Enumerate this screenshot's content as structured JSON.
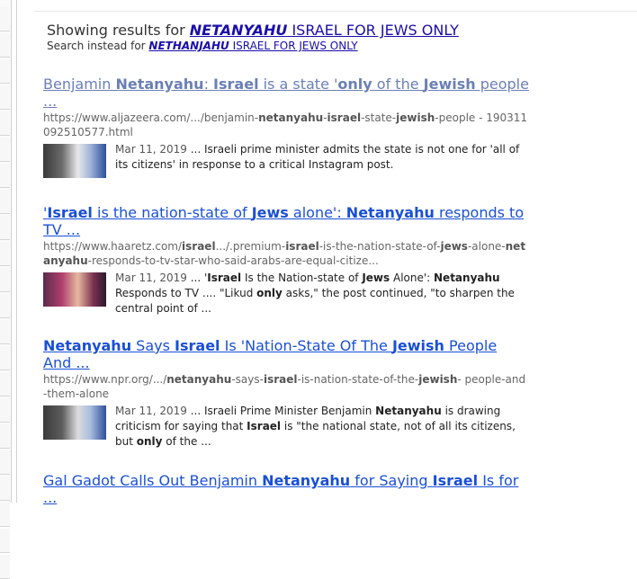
{
  "spell": {
    "showing_prefix": "Showing results for ",
    "showing_bold": "NETANYAHU",
    "showing_rest": " ISRAEL FOR JEWS ONLY",
    "instead_prefix": "Search instead for ",
    "instead_bold": "NETHANJAHU",
    "instead_rest": " ISRAEL FOR JEWS ONLY"
  },
  "results": [
    {
      "title_parts": [
        {
          "t": "Benjamin ",
          "b": false
        },
        {
          "t": "Netanyahu",
          "b": true
        },
        {
          "t": ": ",
          "b": false
        },
        {
          "t": "Israel",
          "b": true
        },
        {
          "t": " is a state '",
          "b": false
        },
        {
          "t": "only",
          "b": true
        },
        {
          "t": " of the ",
          "b": false
        },
        {
          "t": "Jewish",
          "b": true
        },
        {
          "t": " people ...",
          "b": false
        }
      ],
      "visited": true,
      "url_parts": [
        {
          "t": "https://www.aljazeera.com/.../benjamin-",
          "b": false
        },
        {
          "t": "netanyahu",
          "b": true
        },
        {
          "t": "-",
          "b": false
        },
        {
          "t": "israel",
          "b": true
        },
        {
          "t": "-state-",
          "b": false
        },
        {
          "t": "jewish",
          "b": true
        },
        {
          "t": "-people - 190311092510577.html",
          "b": false
        }
      ],
      "date": "Mar 11, 2019",
      "snippet_parts": [
        {
          "t": " ... Israeli prime minister admits the state is not one for 'all of its citizens' in response to a critical Instagram post.",
          "b": false
        }
      ]
    },
    {
      "title_parts": [
        {
          "t": "'",
          "b": false
        },
        {
          "t": "Israel",
          "b": true
        },
        {
          "t": " is the nation-state of ",
          "b": false
        },
        {
          "t": "Jews",
          "b": true
        },
        {
          "t": " alone': ",
          "b": false
        },
        {
          "t": "Netanyahu",
          "b": true
        },
        {
          "t": " responds to TV ...",
          "b": false
        }
      ],
      "visited": false,
      "url_parts": [
        {
          "t": "https://www.haaretz.com/",
          "b": false
        },
        {
          "t": "israel",
          "b": true
        },
        {
          "t": ".../.premium-",
          "b": false
        },
        {
          "t": "israel",
          "b": true
        },
        {
          "t": "-is-the-nation-state-of-",
          "b": false
        },
        {
          "t": "jews",
          "b": true
        },
        {
          "t": "-alone-",
          "b": false
        },
        {
          "t": "netanyahu",
          "b": true
        },
        {
          "t": "-responds-to-tv-star-who-said-arabs-are-equal-citize...",
          "b": false
        }
      ],
      "date": "Mar 11, 2019",
      "snippet_parts": [
        {
          "t": " ... '",
          "b": false
        },
        {
          "t": "Israel",
          "b": true
        },
        {
          "t": " Is the Nation-state of ",
          "b": false
        },
        {
          "t": "Jews",
          "b": true
        },
        {
          "t": " Alone': ",
          "b": false
        },
        {
          "t": "Netanyahu",
          "b": true
        },
        {
          "t": " Responds to TV .... \"Likud ",
          "b": false
        },
        {
          "t": "only",
          "b": true
        },
        {
          "t": " asks,\" the post continued, \"to sharpen the central point of ...",
          "b": false
        }
      ]
    },
    {
      "title_parts": [
        {
          "t": "Netanyahu",
          "b": true
        },
        {
          "t": " Says ",
          "b": false
        },
        {
          "t": "Israel",
          "b": true
        },
        {
          "t": " Is 'Nation-State Of The ",
          "b": false
        },
        {
          "t": "Jewish",
          "b": true
        },
        {
          "t": " People And ...",
          "b": false
        }
      ],
      "visited": false,
      "url_parts": [
        {
          "t": "https://www.npr.org/.../",
          "b": false
        },
        {
          "t": "netanyahu",
          "b": true
        },
        {
          "t": "-says-",
          "b": false
        },
        {
          "t": "israel",
          "b": true
        },
        {
          "t": "-is-nation-state-of-the-",
          "b": false
        },
        {
          "t": "jewish",
          "b": true
        },
        {
          "t": "- people-and-them-alone",
          "b": false
        }
      ],
      "date": "Mar 11, 2019",
      "snippet_parts": [
        {
          "t": " ... Israeli Prime Minister Benjamin ",
          "b": false
        },
        {
          "t": "Netanyahu",
          "b": true
        },
        {
          "t": " is drawing criticism for saying that ",
          "b": false
        },
        {
          "t": "Israel",
          "b": true
        },
        {
          "t": " is \"the national state, not of all its citizens, but ",
          "b": false
        },
        {
          "t": "only",
          "b": true
        },
        {
          "t": " of the ...",
          "b": false
        }
      ]
    },
    {
      "title_parts": [
        {
          "t": "Gal Gadot Calls Out Benjamin ",
          "b": false
        },
        {
          "t": "Netanyahu",
          "b": true
        },
        {
          "t": " for Saying ",
          "b": false
        },
        {
          "t": "Israel",
          "b": true
        },
        {
          "t": " Is for ...",
          "b": false
        }
      ],
      "visited": false,
      "url_parts": [],
      "date": "",
      "snippet_parts": []
    }
  ],
  "colors": {
    "link": "#1a4fd6",
    "visited": "#6b7fb5",
    "url": "#666666"
  }
}
